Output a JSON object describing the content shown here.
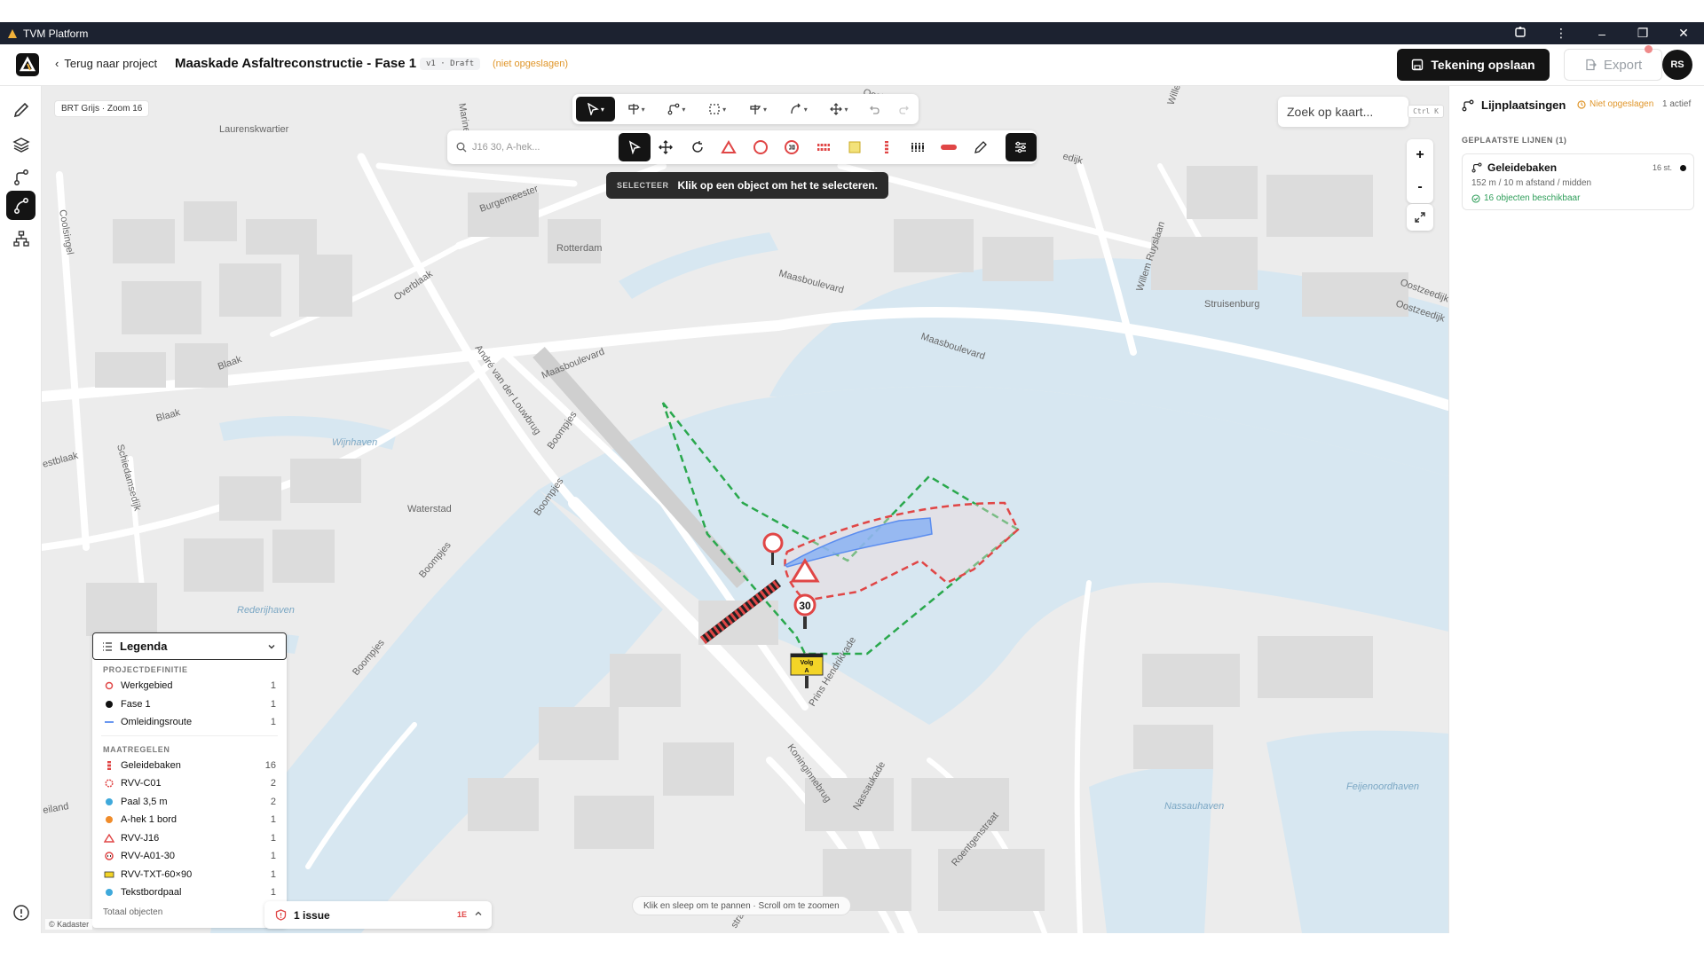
{
  "titlebar": {
    "app_name": "TVM Platform"
  },
  "header": {
    "back_label": "Terug naar project",
    "title": "Maaskade Asfaltreconstructie - Fase 1",
    "version": "v1 · Draft",
    "unsaved": "(niet opgeslagen)",
    "save_label": "Tekening opslaan",
    "export_label": "Export",
    "avatar_initials": "RS"
  },
  "map": {
    "base_label": "BRT Grijs · Zoom 16",
    "search_placeholder": "J16 30, A-hek...",
    "map_search_placeholder": "Zoek op kaart...",
    "map_search_shortcut": "Ctrl K",
    "zoom_in": "+",
    "zoom_out": "-",
    "tooltip_tag": "SELECTEER",
    "tooltip_text": "Klik op een object om het te selecteren.",
    "hint": "Klik en sleep om te pannen · Scroll om te zoomen",
    "attribution": "© Kadaster",
    "sign_speed": "30",
    "sign_text_1": "Volg",
    "sign_text_2": "A",
    "labels": {
      "laurenskwartier": "Laurenskwartier",
      "rotterdam": "Rotterdam",
      "overblaak": "Overblaak",
      "burgemeester": "Burgemeester",
      "blaak1": "Blaak",
      "blaak2": "Blaak",
      "maasboulevard1": "Maasboulevard",
      "maasboulevard2": "Maasboulevard",
      "maasboulevard3": "Maasboulevard",
      "struisenburg": "Struisenburg",
      "oostzeedijk1": "Oostzeedijk",
      "oostzeedijk2": "Oostzeedijk",
      "willem_ruyslaan": "Willem Ruyslaan",
      "andre": "André van der Louwbrug",
      "boompjes1": "Boompjes",
      "boompjes2": "Boompjes",
      "boompjes3": "Boompjes",
      "boompjes4": "Boompjes",
      "wijnhaven": "Wijnhaven",
      "waterstad": "Waterstad",
      "schiedamsedijk": "Schiedamsedijk",
      "coolsingel": "Coolsingel",
      "westblaak": "estblaak",
      "rederijhaven": "Rederijhaven",
      "prins_hendrikkade": "Prins Hendrikkade",
      "koninginnebrug": "Koninginnebrug",
      "nassaukade": "Nassaukade",
      "roentgenstraat": "Roentgenstraat",
      "nassauhaven": "Nassauhaven",
      "feijenoordhaven": "Feijenoordhaven",
      "marine": "Marine",
      "oostp": "Oostp",
      "wille": "Wille",
      "edijk": "edijk",
      "eiland": "eiland",
      "stra": "stra"
    }
  },
  "legend": {
    "title": "Legenda",
    "section1": "PROJECTDEFINITIE",
    "section2": "MAATREGELEN",
    "rows1": [
      {
        "label": "Werkgebied",
        "count": "1"
      },
      {
        "label": "Fase 1",
        "count": "1"
      },
      {
        "label": "Omleidingsroute",
        "count": "1"
      }
    ],
    "rows2": [
      {
        "label": "Geleidebaken",
        "count": "16"
      },
      {
        "label": "RVV-C01",
        "count": "2"
      },
      {
        "label": "Paal 3,5 m",
        "count": "2"
      },
      {
        "label": "A-hek 1 bord",
        "count": "1"
      },
      {
        "label": "RVV-J16",
        "count": "1"
      },
      {
        "label": "RVV-A01-30",
        "count": "1"
      },
      {
        "label": "RVV-TXT-60×90",
        "count": "1"
      },
      {
        "label": "Tekstbordpaal",
        "count": "1"
      }
    ],
    "total_label": "Totaal objecten"
  },
  "issues": {
    "label": "1 issue",
    "count": "1E"
  },
  "right_panel": {
    "title": "Lijnplaatsingen",
    "unsaved": "Niet opgeslagen",
    "active": "1 actief",
    "section": "GEPLAATSTE LIJNEN (1)",
    "card": {
      "title": "Geleidebaken",
      "count": "16 st.",
      "subtitle": "152 m / 10 m afstand / midden",
      "available": "16 objecten beschikbaar"
    }
  },
  "colors": {
    "accent": "#141414",
    "warning": "#e0962a",
    "success": "#2f9e5a",
    "danger": "#e04646",
    "water": "#d7e7f1",
    "route": "#5b8def"
  }
}
